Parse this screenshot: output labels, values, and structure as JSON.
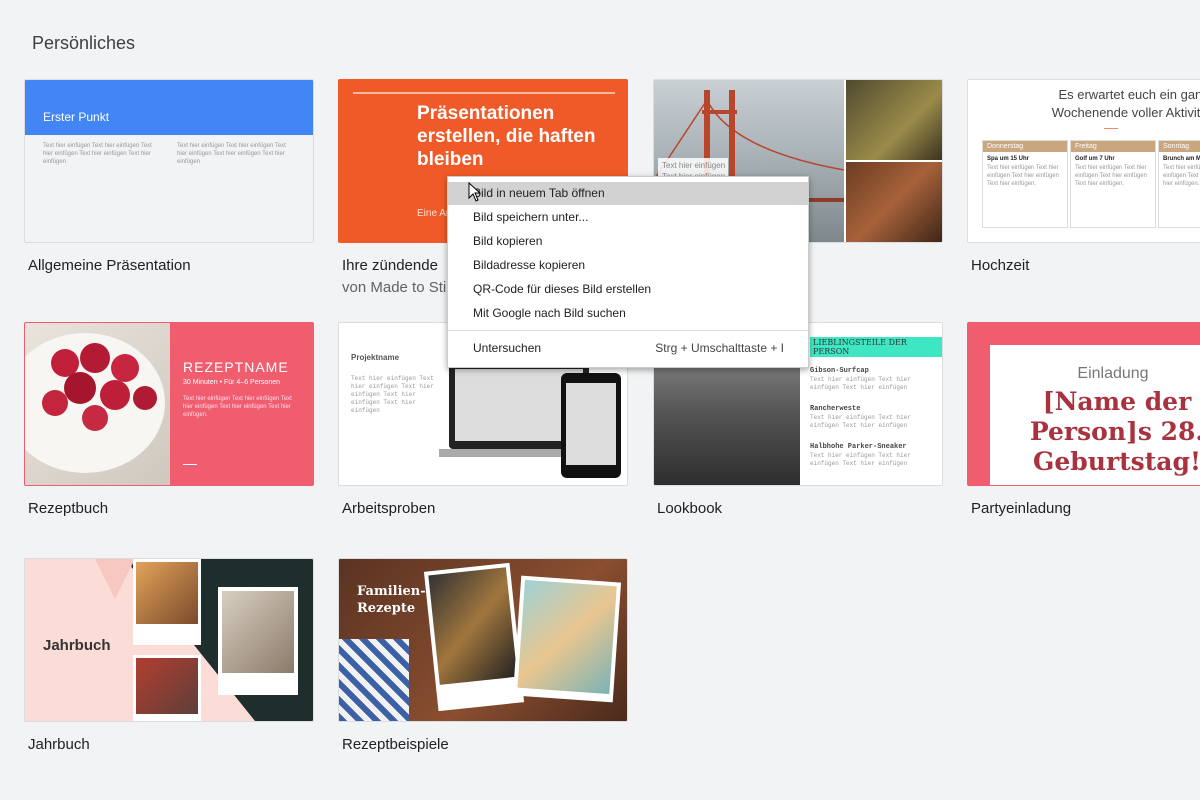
{
  "section": {
    "title": "Persönliches"
  },
  "templates": {
    "t1": {
      "name": "Allgemeine Präsentation",
      "header": "Erster Punkt",
      "body": "Text hier einfügen Text hier einfügen Text hier einfügen Text hier einfügen Text hier einfügen"
    },
    "t2": {
      "name": "Ihre zündende",
      "subtitle": "von Made to Sti",
      "headline": "Präsentationen erstellen, die haften bleiben",
      "footer": "Eine Ar"
    },
    "t3": {
      "caption": "Text hier einfügen"
    },
    "t4": {
      "name": "Hochzeit",
      "headline": "Es erwartet euch ein ganzes Wochenende voller Aktivitäten!",
      "col1_head": "Donnerstag",
      "col1_title": "Spa um 15 Uhr",
      "col2_head": "Freitag",
      "col2_title": "Golf um 7 Uhr",
      "col3_head": "Sonntag",
      "col3_title": "Brunch am M",
      "body": "Text hier einfügen Text hier einfügen Text hier einfügen Text hier einfügen."
    },
    "t5": {
      "name": "Rezeptbuch",
      "title": "REZEPTNAME",
      "meta": "30 Minuten • Für 4–6 Personen",
      "body": "Text hier einfügen Text hier einfügen Text hier einfügen Text hier einfügen Text hier einfügen."
    },
    "t6": {
      "name": "Arbeitsproben",
      "title": "Projektname",
      "body": "Text hier einfügen Text hier einfügen Text hier einfügen Text hier einfügen Text hier einfügen"
    },
    "t7": {
      "name": "Lookbook",
      "title": "LIEBLINGSTEILE DER PERSON",
      "item1": "Gibson-Surfcap",
      "item2": "Rancherweste",
      "item3": "Halbhohe Parker-Sneaker",
      "item_text": "Text hier einfügen Text hier einfügen Text hier einfügen"
    },
    "t8": {
      "name": "Partyeinladung",
      "small": "Einladung",
      "big": "[Name der Person]s 28. Geburtstag!"
    },
    "t9": {
      "name": "Jahrbuch",
      "title": "Jahrbuch"
    },
    "t10": {
      "name": "Rezeptbeispiele",
      "title": "Familien-Rezepte"
    }
  },
  "context_menu": {
    "items": [
      "Bild in neuem Tab öffnen",
      "Bild speichern unter...",
      "Bild kopieren",
      "Bildadresse kopieren",
      "QR-Code für dieses Bild erstellen",
      "Mit Google nach Bild suchen"
    ],
    "inspect": "Untersuchen",
    "inspect_shortcut": "Strg + Umschalttaste + I"
  },
  "colors": {
    "blue": "#4285f4",
    "orange": "#f05a28",
    "pink": "#ef5d6f",
    "wedding_tan": "#c9a67e",
    "mint": "#3ee6c3",
    "party_red": "#a8323e"
  }
}
